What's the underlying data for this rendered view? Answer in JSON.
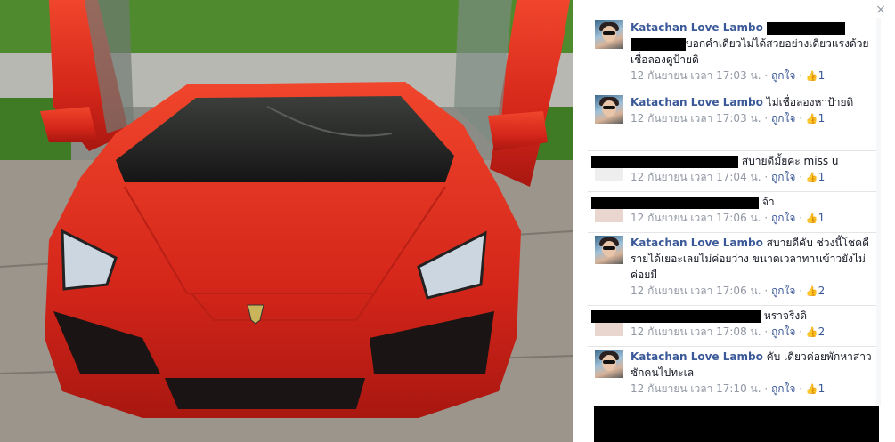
{
  "photo": {
    "subject": "red-sports-car-photo"
  },
  "panel": {
    "close_label": "×"
  },
  "comments": [
    {
      "author": "Katachan Love Lambo",
      "text": "บอกคำเดียวไม่ได้สวยอย่างเดียวแรงด้วย เชื่อลองดูป้ายดิ",
      "time": "12 กันยายน เวลา 17:03 น.",
      "like_label": "ถูกใจ",
      "likes": "1"
    },
    {
      "author": "Katachan Love Lambo",
      "text": "ไม่เชื่อลองหาป้ายดิ",
      "time": "12 กันยายน เวลา 17:03 น.",
      "like_label": "ถูกใจ",
      "likes": "1"
    },
    {
      "author": "",
      "text": "สบายดีมั้ยคะ miss u",
      "time": "12 กันยายน เวลา 17:04 น.",
      "like_label": "ถูกใจ",
      "likes": "1"
    },
    {
      "author": "",
      "text": "จ้า",
      "time": "12 กันยายน เวลา 17:06 น.",
      "like_label": "ถูกใจ",
      "likes": "1"
    },
    {
      "author": "Katachan Love Lambo",
      "text": "สบายดีคับ ช่วงนี้โชคดีรายได้เยอะเลยไม่ค่อยว่าง ขนาดเวลาทานข้าวยังไม่ค่อยมี",
      "time": "12 กันยายน เวลา 17:06 น.",
      "like_label": "ถูกใจ",
      "likes": "2"
    },
    {
      "author": "",
      "text": "หราจริงดิ",
      "time": "12 กันยายน เวลา 17:08 น.",
      "like_label": "ถูกใจ",
      "likes": "2"
    },
    {
      "author": "Katachan Love Lambo",
      "text": "คับ เดี๋ยวค่อยพักหาสาวซักคนไปทะเล",
      "time": "12 กันยายน เวลา 17:10 น.",
      "like_label": "ถูกใจ",
      "likes": "1"
    }
  ],
  "colors": {
    "link": "#3b5998",
    "meta": "#9197a3",
    "car_red": "#e02a1c"
  }
}
